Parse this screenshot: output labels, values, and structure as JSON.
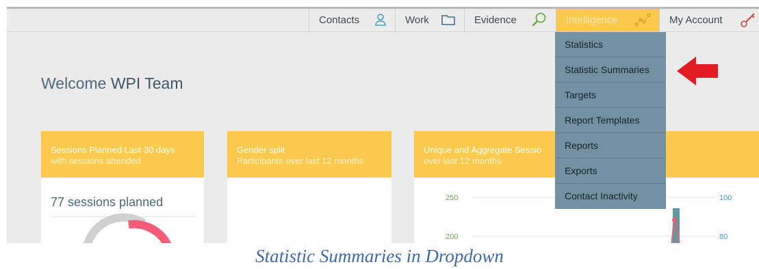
{
  "nav": {
    "contacts": "Contacts",
    "work": "Work",
    "evidence": "Evidence",
    "intelligence": "Intelligence",
    "my_account": "My Account"
  },
  "welcome": {
    "prefix": "Welcome",
    "team": "WPI Team"
  },
  "cards": [
    {
      "title": "Sessions Planned Last 30 days",
      "subtitle": "with sessions attended",
      "stat": "77 sessions planned"
    },
    {
      "title": "Gender split",
      "subtitle": "Participants over last 12 months"
    },
    {
      "title": "Unique and Aggregate Sessio",
      "subtitle": "over last 12 months"
    }
  ],
  "chart_data": {
    "type": "bar",
    "y_left_ticks": [
      "250",
      "200"
    ],
    "y_right_ticks": [
      "100",
      "80"
    ],
    "ylim_left": [
      200,
      250
    ],
    "ylim_right": [
      80,
      100
    ]
  },
  "dropdown": {
    "items": [
      "Statistics",
      "Statistic Summaries",
      "Targets",
      "Report Templates",
      "Reports",
      "Exports",
      "Contact Inactivity"
    ]
  },
  "caption": "Statistic Summaries in Dropdown",
  "colors": {
    "accent": "#fbc94b",
    "menu_bg": "#7391a0",
    "arrow": "#e31b23",
    "caption": "#3f6aa6"
  },
  "icons": [
    "user-icon",
    "folder-icon",
    "magnifier-icon",
    "trend-icon",
    "key-icon",
    "red-arrow-icon"
  ]
}
